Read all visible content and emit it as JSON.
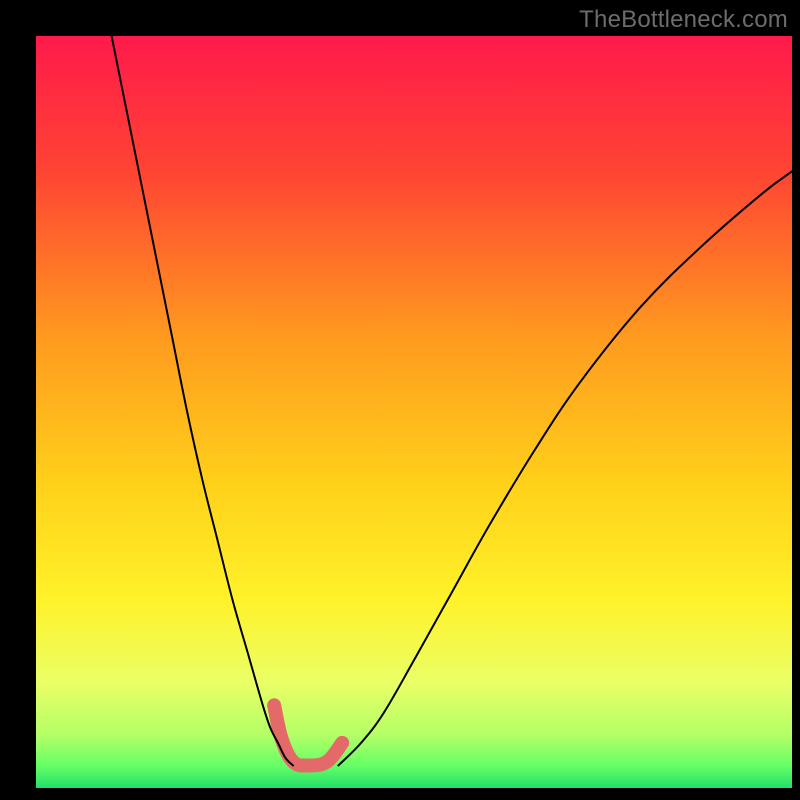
{
  "watermark": "TheBottleneck.com",
  "chart_data": {
    "type": "line",
    "title": "",
    "xlabel": "",
    "ylabel": "",
    "xlim": [
      0,
      100
    ],
    "ylim": [
      0,
      100
    ],
    "background_gradient": {
      "direction": "vertical",
      "stops": [
        {
          "offset": 0.0,
          "color": "#ff1a4b"
        },
        {
          "offset": 0.18,
          "color": "#ff4433"
        },
        {
          "offset": 0.4,
          "color": "#ff9a1f"
        },
        {
          "offset": 0.6,
          "color": "#ffd21a"
        },
        {
          "offset": 0.75,
          "color": "#fff22a"
        },
        {
          "offset": 0.86,
          "color": "#eaff66"
        },
        {
          "offset": 0.93,
          "color": "#b3ff66"
        },
        {
          "offset": 0.97,
          "color": "#66ff66"
        },
        {
          "offset": 1.0,
          "color": "#22e06a"
        }
      ]
    },
    "series": [
      {
        "name": "left-curve",
        "x": [
          10,
          12,
          14,
          16,
          18,
          20,
          22,
          24,
          26,
          28,
          30,
          31,
          32,
          33,
          34
        ],
        "y": [
          100,
          90,
          80,
          70,
          60,
          50,
          41,
          33,
          25,
          18,
          11,
          8,
          6,
          4,
          3
        ],
        "stroke": "#000000",
        "width": 2
      },
      {
        "name": "right-curve",
        "x": [
          40,
          43,
          46,
          50,
          55,
          60,
          66,
          72,
          80,
          88,
          96,
          100
        ],
        "y": [
          3,
          6,
          10,
          17,
          26,
          35,
          45,
          54,
          64,
          72,
          79,
          82
        ],
        "stroke": "#000000",
        "width": 2
      },
      {
        "name": "valley-highlight",
        "x": [
          31.5,
          32.5,
          34.0,
          36.0,
          38.5,
          40.5
        ],
        "y": [
          11.0,
          6.5,
          3.5,
          3.0,
          3.5,
          6.0
        ],
        "stroke": "#e46a6a",
        "width": 14
      }
    ],
    "valley_x": 36,
    "valley_y": 3
  }
}
